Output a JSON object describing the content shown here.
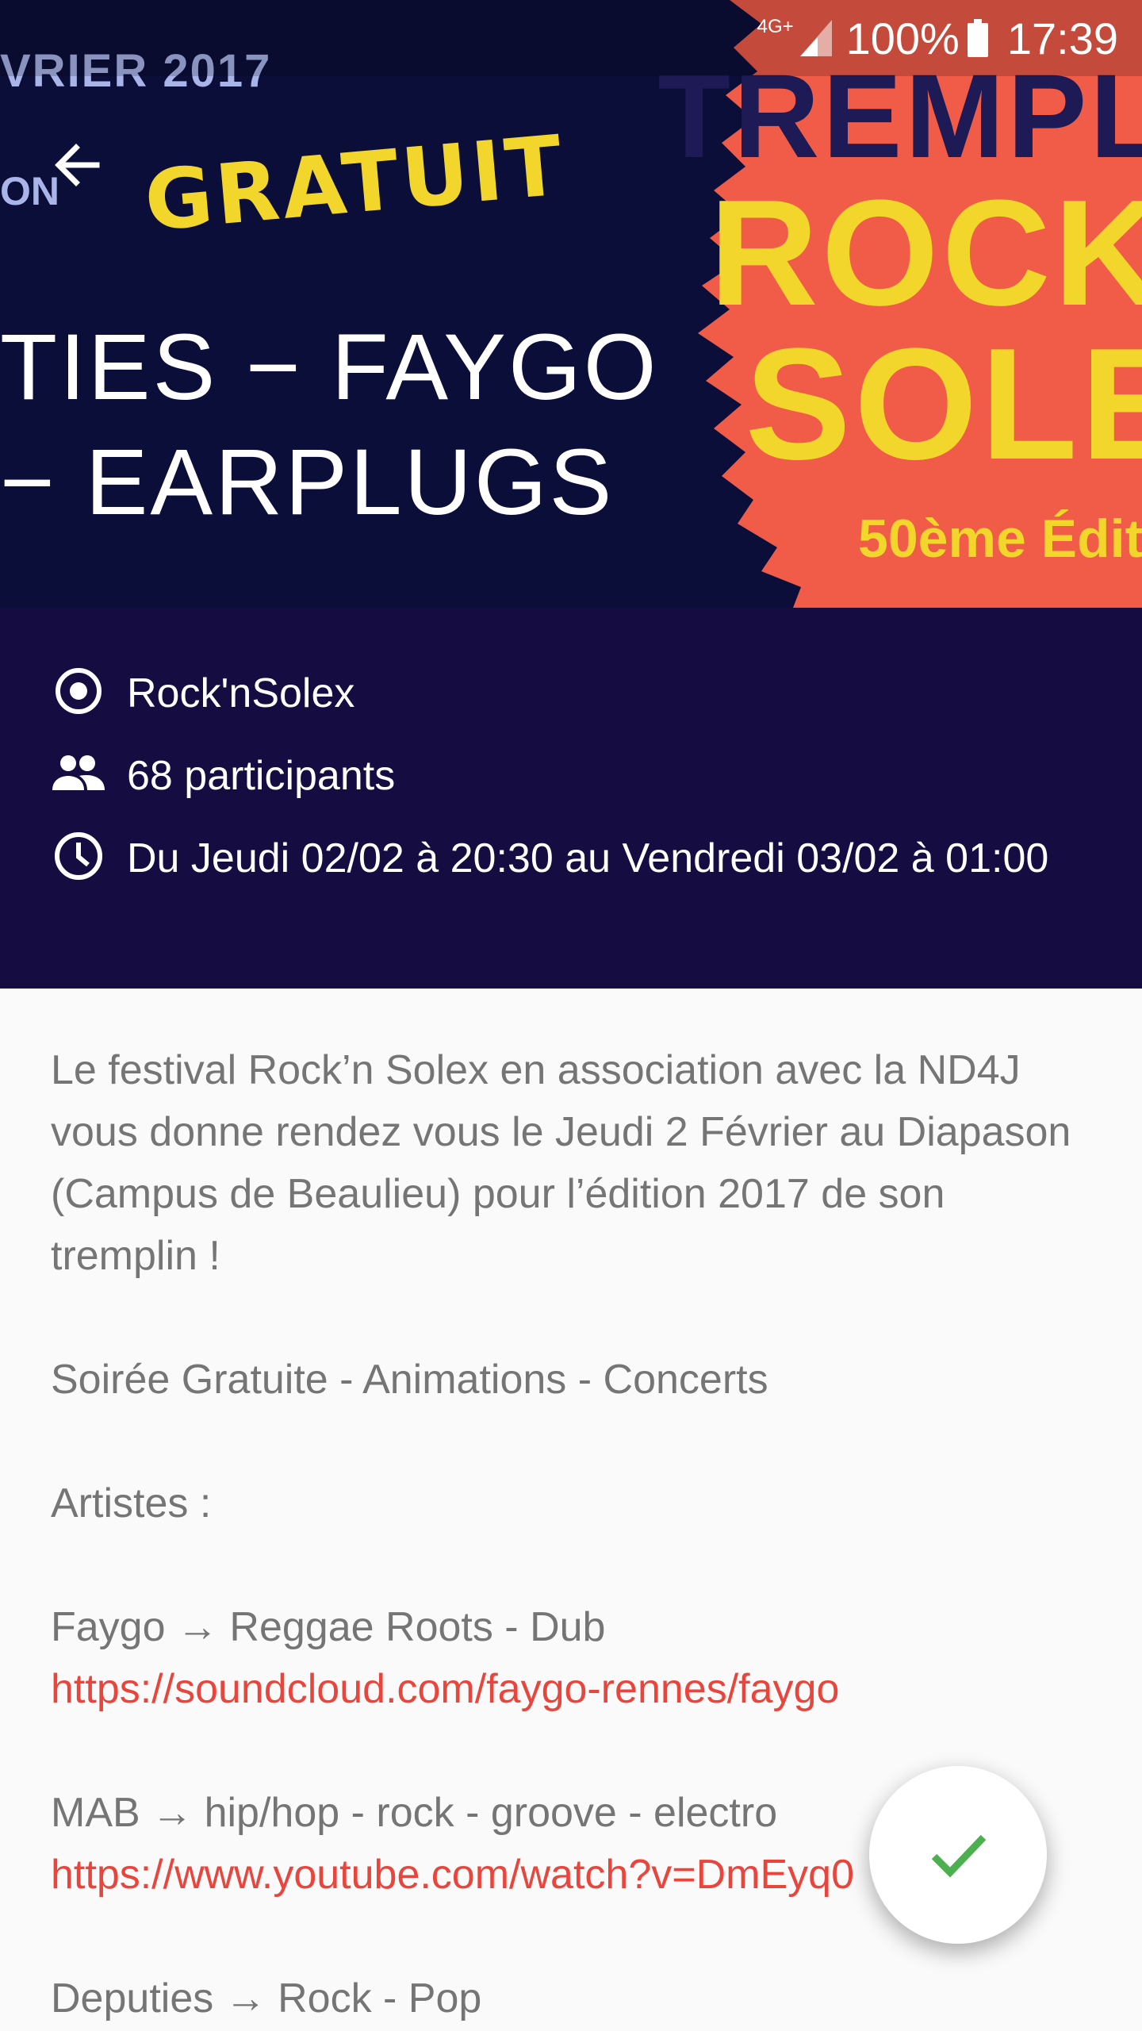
{
  "status_bar": {
    "network": "4G+",
    "battery": "100%",
    "time": "17:39"
  },
  "hero": {
    "date_fragment": "VRIER 2017",
    "venue_fragment": "ON",
    "gratuit": "GRATUIT",
    "band_line1": "TIES − FAYGO",
    "band_line2": "−  EARPLUGS",
    "tremplin": "TREMPL",
    "rock": "ROCK",
    "solex": "SOLE",
    "edition": "50ème Éditi"
  },
  "info": {
    "organizer": "Rock'nSolex",
    "participants": "68 participants",
    "datetime": "Du Jeudi 02/02 à 20:30 au Vendredi 03/02 à 01:00"
  },
  "description": {
    "intro": "Le festival Rock’n Solex en association avec la ND4J vous donne rendez vous le Jeudi 2 Février au Diapason (Campus de Beaulieu) pour l’édition 2017 de son tremplin !",
    "tagline": "Soirée Gratuite - Animations - Concerts",
    "artists_heading": "Artistes :",
    "artist1": "Faygo  → Reggae Roots - Dub",
    "artist1_link": "https://soundcloud.com/faygo-rennes/faygo",
    "artist2": "MAB  → hip/hop - rock - groove - electro",
    "artist2_link": "https://www.youtube.com/watch?v=DmEyq0",
    "artist3": "Deputies → Rock - Pop"
  },
  "colors": {
    "hero_navy": "#0c0e3a",
    "hero_orange": "#f05c48",
    "accent_yellow": "#f2d62b",
    "info_bg": "#150d42",
    "link": "#e8453c",
    "check_green": "#4caf50"
  },
  "icons": {
    "back": "arrow-left-icon",
    "organizer": "radio-target-icon",
    "participants": "people-icon",
    "datetime": "clock-icon",
    "fab": "check-icon"
  }
}
